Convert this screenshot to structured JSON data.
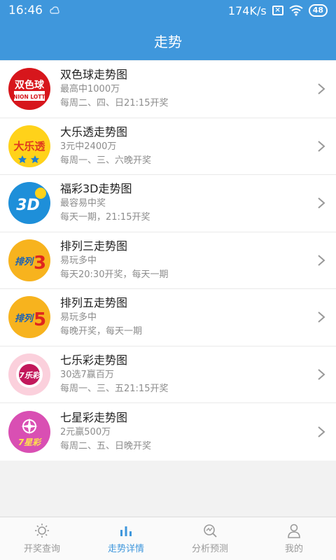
{
  "status_bar": {
    "time": "16:46",
    "speed": "174K/s",
    "battery": "48"
  },
  "header": {
    "title": "走势"
  },
  "lotteries": [
    {
      "name": "双色球走势图",
      "line1": "最高中1000万",
      "line2": "每周二、四、日21:15开奖",
      "logo_text": "双色球",
      "logo_sub": "UNION LOTTO"
    },
    {
      "name": "大乐透走势图",
      "line1": "3元中2400万",
      "line2": "每周一、三、六晚开奖",
      "logo_text": "大乐透"
    },
    {
      "name": "福彩3D走势图",
      "line1": "最容易中奖",
      "line2": "每天一期，21:15开奖",
      "logo_text": "3D"
    },
    {
      "name": "排列三走势图",
      "line1": "易玩多中",
      "line2": "每天20:30开奖，每天一期",
      "logo_text": "排列",
      "logo_num": "3"
    },
    {
      "name": "排列五走势图",
      "line1": "易玩多中",
      "line2": "每晚开奖，每天一期",
      "logo_text": "排列",
      "logo_num": "5"
    },
    {
      "name": "七乐彩走势图",
      "line1": "30选7赢百万",
      "line2": "每周一、三、五21:15开奖",
      "logo_text": "7乐彩"
    },
    {
      "name": "七星彩走势图",
      "line1": "2元赢500万",
      "line2": "每周二、五、日晚开奖",
      "logo_text": "7星彩"
    }
  ],
  "tabs": [
    {
      "label": "开奖查询",
      "icon": "sun-icon",
      "active": false
    },
    {
      "label": "走势详情",
      "icon": "bar-chart-icon",
      "active": true
    },
    {
      "label": "分析预测",
      "icon": "analysis-icon",
      "active": false
    },
    {
      "label": "我的",
      "icon": "user-icon",
      "active": false
    }
  ],
  "colors": {
    "primary": "#3f97dc",
    "background": "#f2f2f2",
    "inactive_tab": "#9a9a9a"
  }
}
